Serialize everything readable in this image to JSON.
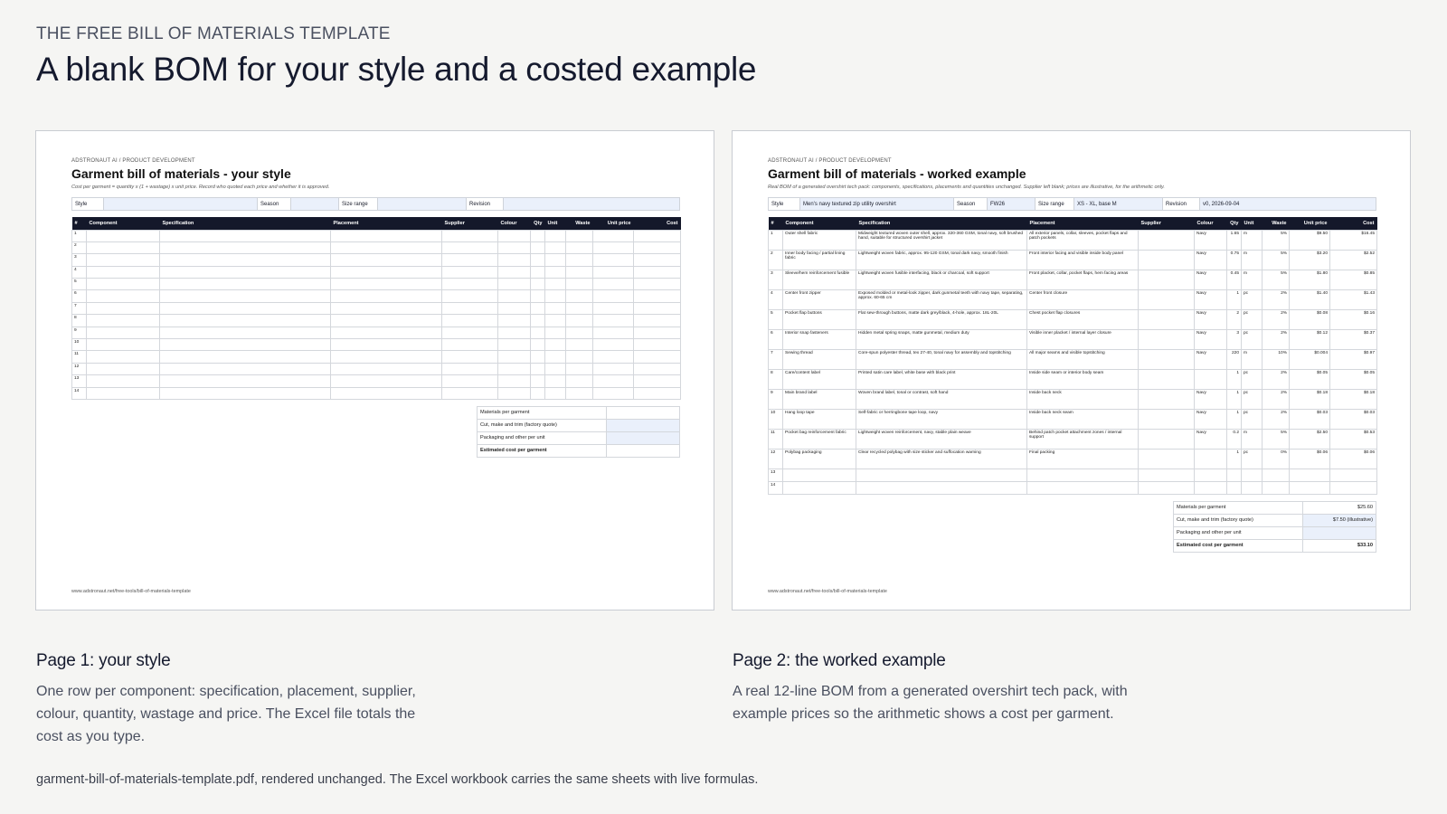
{
  "header": {
    "eyebrow": "THE FREE BILL OF MATERIALS TEMPLATE",
    "title": "A blank BOM for your style and a costed example"
  },
  "columns": [
    "#",
    "Component",
    "Specification",
    "Placement",
    "Supplier",
    "Colour",
    "Qty",
    "Unit",
    "Waste",
    "Unit price",
    "Cost"
  ],
  "blank_page": {
    "eyebrow": "ADSTRONAUT AI / PRODUCT DEVELOPMENT",
    "title": "Garment bill of materials - your style",
    "note": "Cost per garment = quantity x (1 + wastage) x unit price. Record who quoted each price and whether it is approved.",
    "meta": [
      {
        "label": "Style",
        "value": ""
      },
      {
        "label": "Season",
        "value": ""
      },
      {
        "label": "Size range",
        "value": ""
      },
      {
        "label": "Revision",
        "value": ""
      }
    ],
    "row_numbers": [
      "1",
      "2",
      "3",
      "4",
      "5",
      "6",
      "7",
      "8",
      "9",
      "10",
      "11",
      "12",
      "13",
      "14"
    ],
    "totals": [
      {
        "label": "Materials per garment",
        "value": ""
      },
      {
        "label": "Cut, make and trim (factory quote)",
        "value": ""
      },
      {
        "label": "Packaging and other per unit",
        "value": ""
      },
      {
        "label": "Estimated cost per garment",
        "value": ""
      }
    ],
    "footer": "www.adstronaut.net/free-tools/bill-of-materials-template"
  },
  "example_page": {
    "eyebrow": "ADSTRONAUT AI / PRODUCT DEVELOPMENT",
    "title": "Garment bill of materials - worked example",
    "note": "Real BOM of a generated overshirt tech pack: components, specifications, placements and quantities unchanged. Supplier left blank; prices are illustrative, for the arithmetic only.",
    "meta": [
      {
        "label": "Style",
        "value": "Men's navy textured zip utility overshirt"
      },
      {
        "label": "Season",
        "value": "FW26"
      },
      {
        "label": "Size range",
        "value": "XS - XL, base M"
      },
      {
        "label": "Revision",
        "value": "v0, 2026-09-04"
      }
    ],
    "rows": [
      [
        "1",
        "Outer shell fabric",
        "Midweight textured woven outer shell, approx. 320-360 GSM, tonal navy, soft brushed hand, suitable for structured overshirt jacket",
        "All exterior panels, collar, sleeves, pocket flaps and patch pockets",
        "",
        "Navy",
        "1.65",
        "m",
        "5%",
        "$9.50",
        "$16.45"
      ],
      [
        "2",
        "Inner body facing / partial lining fabric",
        "Lightweight woven fabric, approx. 95-120 GSM, tonal dark navy, smooth finish",
        "Front interior facing and visible inside body panel",
        "",
        "Navy",
        "0.75",
        "m",
        "5%",
        "$3.20",
        "$2.52"
      ],
      [
        "3",
        "Sleeve/hem reinforcement fusible",
        "Lightweight woven fusible interfacing, black or charcoal, soft support",
        "Front placket, collar, pocket flaps, hem facing areas",
        "",
        "Navy",
        "0.45",
        "m",
        "5%",
        "$1.80",
        "$0.85"
      ],
      [
        "4",
        "Center front zipper",
        "Exposed molded or metal-look zipper, dark gunmetal teeth with navy tape, separating, approx. 60-65 cm",
        "Center front closure",
        "",
        "Navy",
        "1",
        "pc",
        "2%",
        "$1.40",
        "$1.43"
      ],
      [
        "5",
        "Pocket flap buttons",
        "Flat sew-through buttons, matte dark grey/black, 4-hole, approx. 18L-20L",
        "Chest pocket flap closures",
        "",
        "Navy",
        "2",
        "pc",
        "2%",
        "$0.08",
        "$0.16"
      ],
      [
        "6",
        "Interior snap fasteners",
        "Hidden metal spring snaps, matte gunmetal, medium duty",
        "Visible inner placket / internal layer closure",
        "",
        "Navy",
        "3",
        "pc",
        "2%",
        "$0.12",
        "$0.37"
      ],
      [
        "7",
        "Sewing thread",
        "Core-spun polyester thread, tex 27-40, tonal navy for assembly and topstitching",
        "All major seams and visible topstitching",
        "",
        "Navy",
        "220",
        "m",
        "10%",
        "$0.004",
        "$0.97"
      ],
      [
        "8",
        "Care/content label",
        "Printed satin care label, white base with black print",
        "Inside side seam or interior body seam",
        "",
        "",
        "1",
        "pc",
        "2%",
        "$0.05",
        "$0.05"
      ],
      [
        "9",
        "Main brand label",
        "Woven brand label, tonal or contrast, soft hand",
        "Inside back neck",
        "",
        "Navy",
        "1",
        "pc",
        "2%",
        "$0.18",
        "$0.18"
      ],
      [
        "10",
        "Hang loop tape",
        "Self-fabric or herringbone tape loop, navy",
        "Inside back neck seam",
        "",
        "Navy",
        "1",
        "pc",
        "2%",
        "$0.03",
        "$0.03"
      ],
      [
        "11",
        "Pocket bag reinforcement fabric",
        "Lightweight woven reinforcement, navy, stable plain weave",
        "Behind patch pocket attachment zones / internal support",
        "",
        "Navy",
        "0.2",
        "m",
        "5%",
        "$2.50",
        "$0.53"
      ],
      [
        "12",
        "Polybag packaging",
        "Clear recycled polybag with size sticker and suffocation warning",
        "Final packing",
        "",
        "",
        "1",
        "pc",
        "0%",
        "$0.06",
        "$0.06"
      ],
      [
        "13",
        "",
        "",
        "",
        "",
        "",
        "",
        "",
        "",
        "",
        ""
      ],
      [
        "14",
        "",
        "",
        "",
        "",
        "",
        "",
        "",
        "",
        "",
        ""
      ]
    ],
    "totals": [
      {
        "label": "Materials per garment",
        "value": "$25.60"
      },
      {
        "label": "Cut, make and trim (factory quote)",
        "value": "$7.50 (illustrative)"
      },
      {
        "label": "Packaging and other per unit",
        "value": ""
      },
      {
        "label": "Estimated cost per garment",
        "value": "$33.10"
      }
    ],
    "footer": "www.adstronaut.net/free-tools/bill-of-materials-template"
  },
  "captions": {
    "left_title": "Page 1: your style",
    "left_body": "One row per component: specification, placement, supplier, colour, quantity, wastage and price. The Excel file totals the cost as you type.",
    "right_title": "Page 2: the worked example",
    "right_body": "A real 12-line BOM from a generated overshirt tech pack, with example prices so the arithmetic shows a cost per garment."
  },
  "footnote": "garment-bill-of-materials-template.pdf, rendered unchanged. The Excel workbook carries the same sheets with live formulas."
}
